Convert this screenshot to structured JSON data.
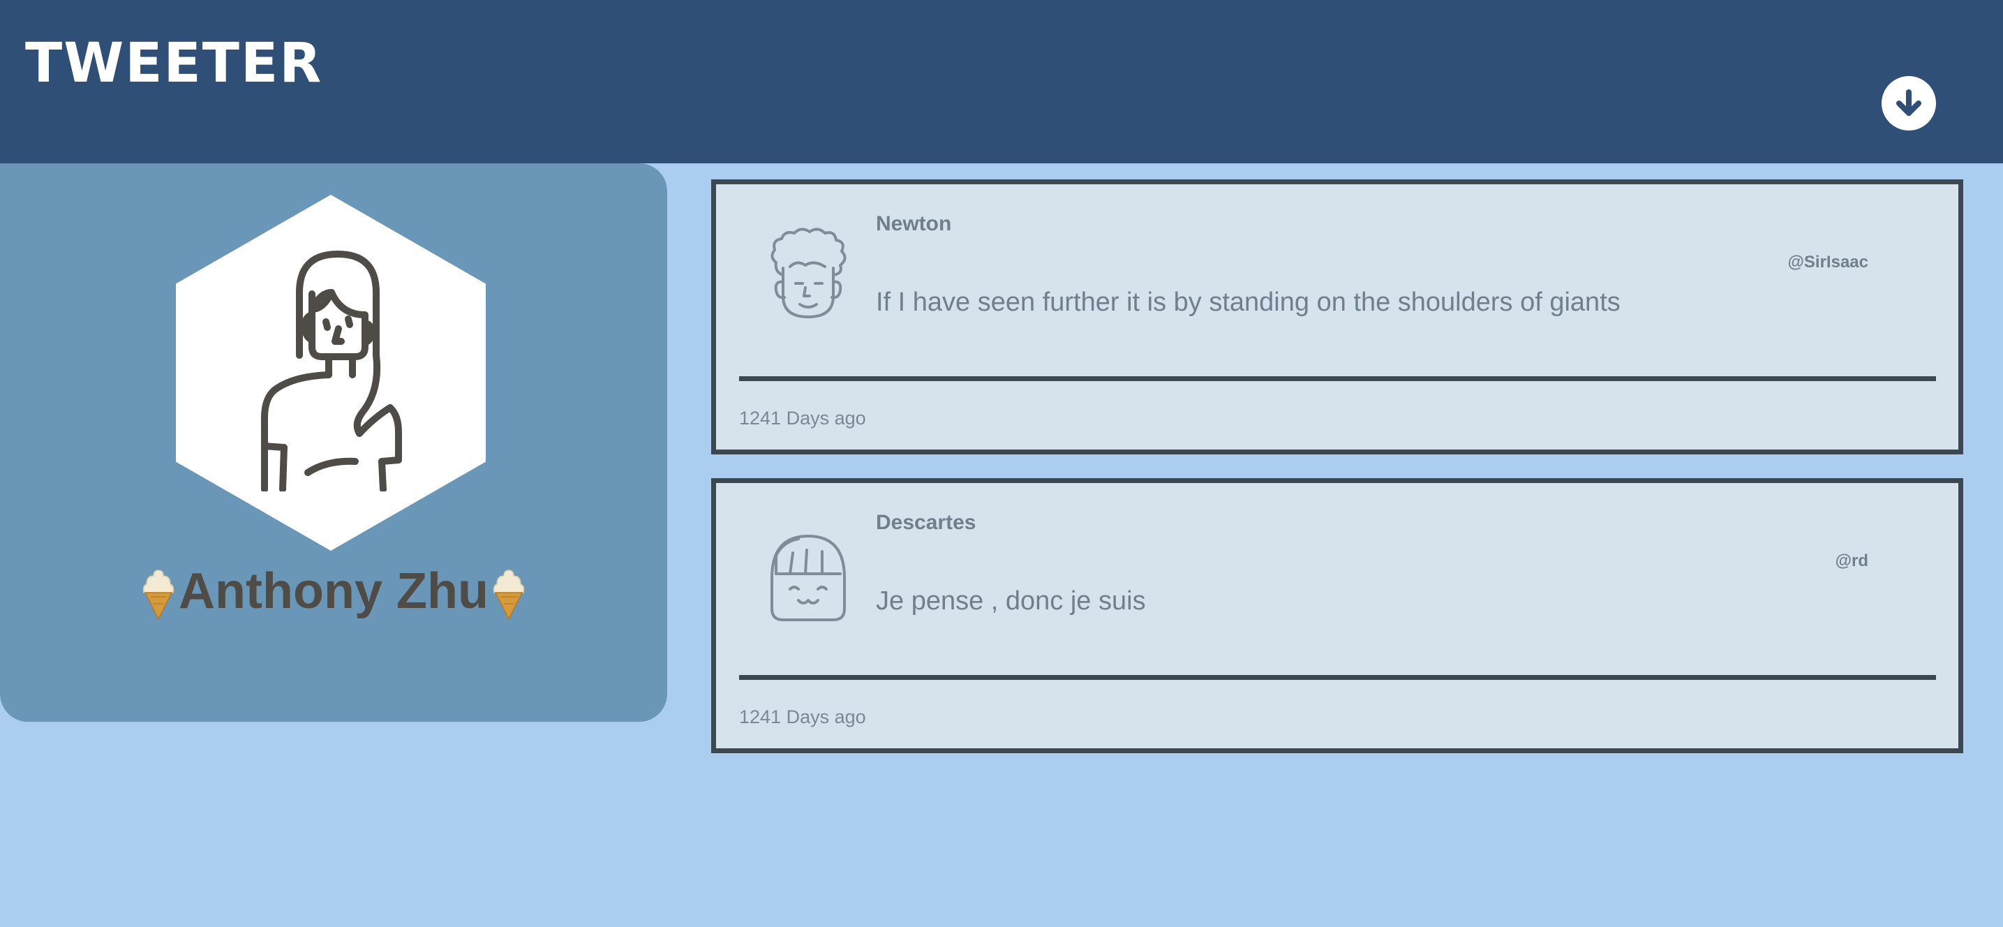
{
  "header": {
    "brand": "TWEETER",
    "action_icon": "arrow-down-circle-icon"
  },
  "profile": {
    "name": "Anthony Zhu",
    "avatar_icon": "woman-avatar-icon",
    "decoration_icon": "ice-cream-cone-icon"
  },
  "tweets": [
    {
      "author": "Newton",
      "handle": "@SirIsaac",
      "text": "If I have seen further it is by standing on the shoulders of giants",
      "time": "1241 Days ago",
      "avatar_icon": "curly-hair-avatar-icon"
    },
    {
      "author": "Descartes",
      "handle": "@rd",
      "text": "Je pense , donc je suis",
      "time": "1241 Days ago",
      "avatar_icon": "bangs-avatar-icon"
    }
  ],
  "colors": {
    "header": "#2f4f76",
    "page_bg": "#abcdef",
    "profile_card": "#6a96b8",
    "tweet_bg": "#d6e3ed",
    "tweet_border": "#3c4752"
  }
}
